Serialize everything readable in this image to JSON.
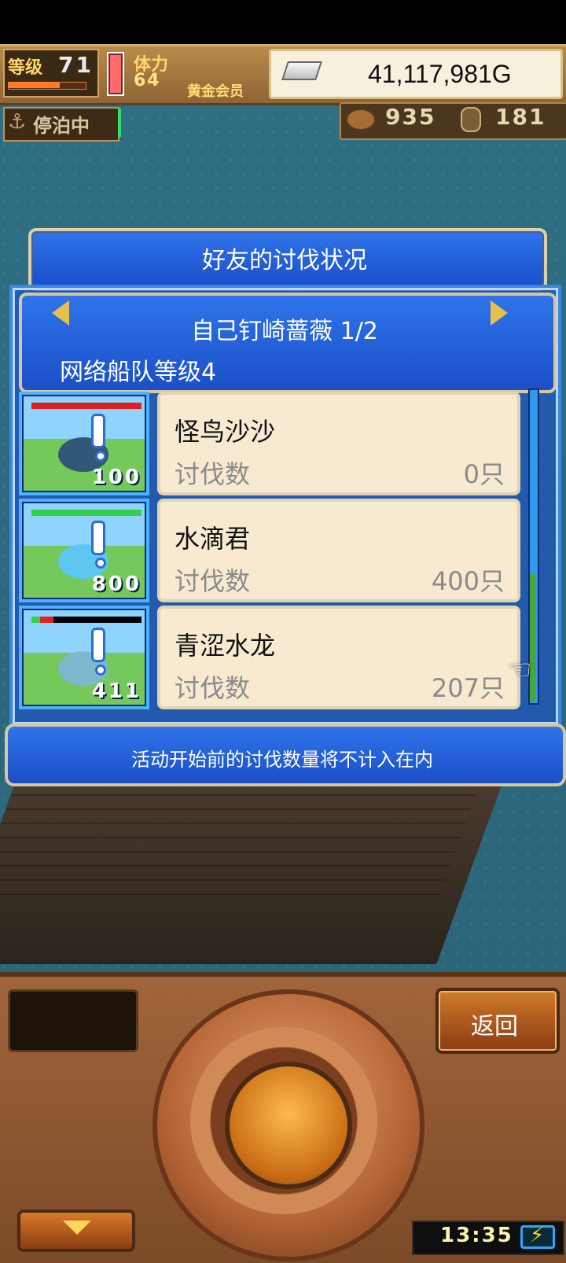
{
  "hud": {
    "level_label": "等级",
    "level_value": "71",
    "level_progress_percent": 66,
    "stamina_label": "体力",
    "stamina_value": "64",
    "membership": "黄金会员",
    "money": "41,117,981G",
    "docking_status": "停泊中",
    "resource1_value": "935",
    "resource2_value": "181"
  },
  "dialog": {
    "title": "好友的讨伐状况",
    "friend_name": "自己钉崎蔷薇 1/2",
    "fleet_level": "网络船队等级4",
    "rows": [
      {
        "thumb_count": "100",
        "name": "怪鸟沙沙",
        "label": "讨伐数",
        "value": "0只"
      },
      {
        "thumb_count": "800",
        "name": "水滴君",
        "label": "讨伐数",
        "value": "400只"
      },
      {
        "thumb_count": "411",
        "name": "青涩水龙",
        "label": "讨伐数",
        "value": "207只"
      }
    ],
    "footer_note": "活动开始前的讨伐数量将不计入在内"
  },
  "controls": {
    "back_label": "返回",
    "clock": "13:35"
  },
  "colors": {
    "accent_blue": "#2f74ea",
    "gold_border": "#d8c79b",
    "card_bg": "#f7ead1"
  }
}
